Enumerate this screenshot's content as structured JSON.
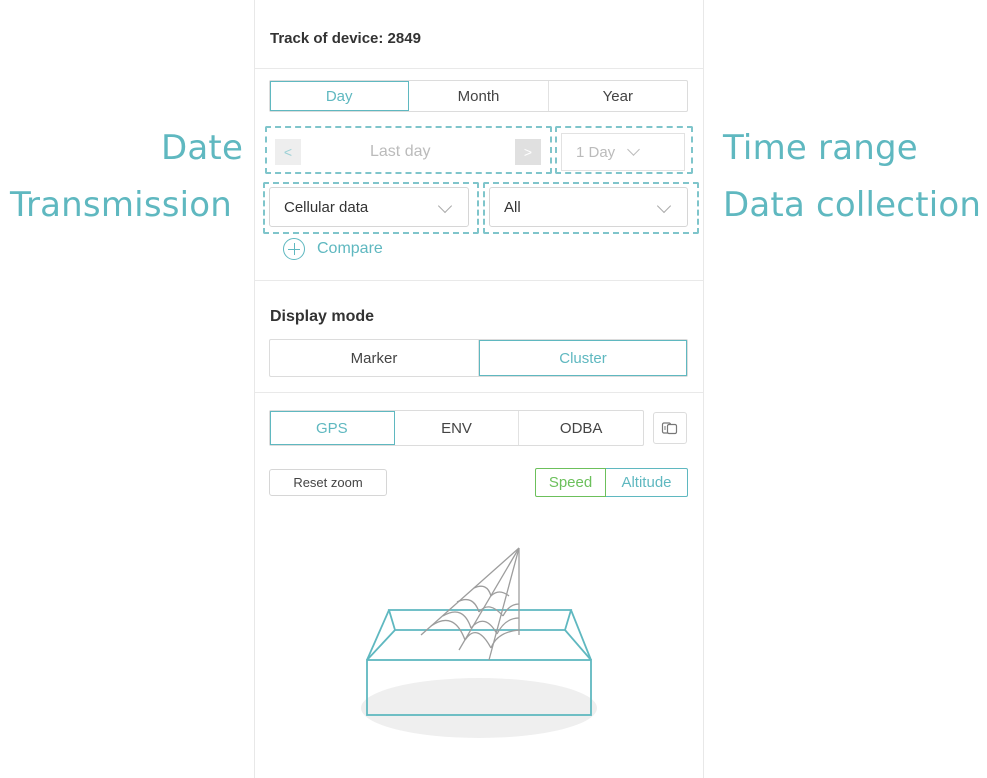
{
  "annotations": {
    "date": "Date",
    "time_range": "Time range",
    "transmission": "Transmission",
    "data_collection": "Data collection"
  },
  "panel": {
    "title": "Track of device: 2849",
    "period_tabs": [
      "Day",
      "Month",
      "Year"
    ],
    "active_period": "Day",
    "date_nav": {
      "prev": "<",
      "label": "Last day",
      "next": ">"
    },
    "range_select": "1 Day",
    "transmission_select": "Cellular data",
    "collection_select": "All",
    "compare_label": "Compare",
    "display_mode_title": "Display mode",
    "display_modes": [
      "Marker",
      "Cluster"
    ],
    "active_display_mode": "Cluster",
    "data_tabs": [
      "GPS",
      "ENV",
      "ODBA"
    ],
    "active_data_tab": "GPS",
    "reset_zoom": "Reset zoom",
    "chart_toggle": [
      "Speed",
      "Altitude"
    ],
    "empty_state_icon": "empty-box-with-net-icon",
    "layers_icon": "layers-icon"
  },
  "colors": {
    "accent": "#5fb8c0",
    "speed_green": "#6cc05b",
    "annotation": "#5fb8c0"
  }
}
